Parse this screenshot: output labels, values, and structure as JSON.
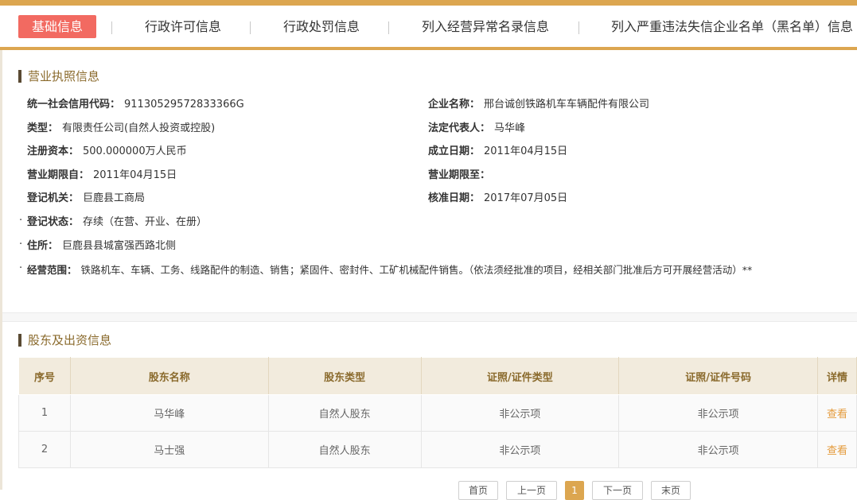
{
  "tabs": {
    "basic": "基础信息",
    "permit": "行政许可信息",
    "penalty": "行政处罚信息",
    "abnormal": "列入经营异常名录信息",
    "blacklist": "列入严重违法失信企业名单（黑名单）信息"
  },
  "license": {
    "title": "营业执照信息",
    "credit_code_label": "统一社会信用代码：",
    "credit_code": "91130529572833366G",
    "name_label": "企业名称：",
    "name": "邢台诚创铁路机车车辆配件有限公司",
    "type_label": "类型：",
    "type": "有限责任公司(自然人投资或控股)",
    "rep_label": "法定代表人：",
    "rep": "马华峰",
    "capital_label": "注册资本：",
    "capital": "500.000000万人民币",
    "founded_label": "成立日期：",
    "founded": "2011年04月15日",
    "term_from_label": "营业期限自：",
    "term_from": "2011年04月15日",
    "term_to_label": "营业期限至：",
    "term_to": "",
    "authority_label": "登记机关：",
    "authority": "巨鹿县工商局",
    "approved_label": "核准日期：",
    "approved": "2017年07月05日",
    "status_label": "登记状态：",
    "status": "存续（在营、开业、在册）",
    "address_label": "住所：",
    "address": "巨鹿县县城富强西路北侧",
    "scope_label": "经营范围：",
    "scope": "铁路机车、车辆、工务、线路配件的制造、销售；紧固件、密封件、工矿机械配件销售。（依法须经批准的项目，经相关部门批准后方可开展经营活动）**"
  },
  "shareholders": {
    "title": "股东及出资信息",
    "headers": {
      "seq": "序号",
      "name": "股东名称",
      "type": "股东类型",
      "id_type": "证照/证件类型",
      "id_no": "证照/证件号码",
      "detail": "详情"
    },
    "rows": [
      {
        "seq": "1",
        "name": "马华峰",
        "type": "自然人股东",
        "id_type": "非公示项",
        "id_no": "非公示项",
        "detail": "查看"
      },
      {
        "seq": "2",
        "name": "马士强",
        "type": "自然人股东",
        "id_type": "非公示项",
        "id_no": "非公示项",
        "detail": "查看"
      }
    ]
  },
  "pager": {
    "first": "首页",
    "prev": "上一页",
    "current": "1",
    "next": "下一页",
    "last": "末页"
  }
}
